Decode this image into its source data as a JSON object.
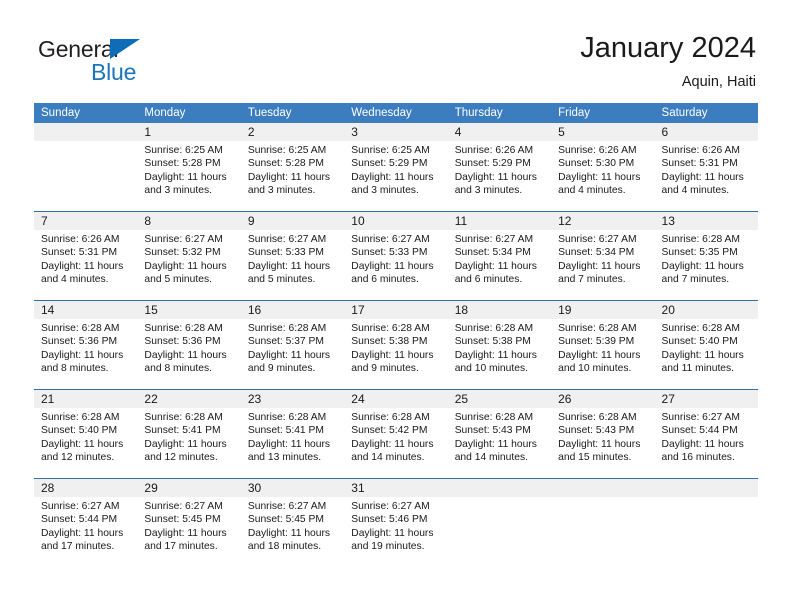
{
  "logo": {
    "word_top": "General",
    "word_bottom": "Blue",
    "triangle_color": "#0f6cb6",
    "blue_color": "#1b75bc"
  },
  "header": {
    "title": "January 2024",
    "subtitle": "Aquin, Haiti",
    "header_bg": "#3c7dc0",
    "row_border": "#2f6fad",
    "date_band_bg": "#f0f0f0"
  },
  "weekdays": [
    "Sunday",
    "Monday",
    "Tuesday",
    "Wednesday",
    "Thursday",
    "Friday",
    "Saturday"
  ],
  "weeks": [
    {
      "days": [
        {
          "num": "",
          "lines": []
        },
        {
          "num": "1",
          "lines": [
            "Sunrise: 6:25 AM",
            "Sunset: 5:28 PM",
            "Daylight: 11 hours",
            "and 3 minutes."
          ]
        },
        {
          "num": "2",
          "lines": [
            "Sunrise: 6:25 AM",
            "Sunset: 5:28 PM",
            "Daylight: 11 hours",
            "and 3 minutes."
          ]
        },
        {
          "num": "3",
          "lines": [
            "Sunrise: 6:25 AM",
            "Sunset: 5:29 PM",
            "Daylight: 11 hours",
            "and 3 minutes."
          ]
        },
        {
          "num": "4",
          "lines": [
            "Sunrise: 6:26 AM",
            "Sunset: 5:29 PM",
            "Daylight: 11 hours",
            "and 3 minutes."
          ]
        },
        {
          "num": "5",
          "lines": [
            "Sunrise: 6:26 AM",
            "Sunset: 5:30 PM",
            "Daylight: 11 hours",
            "and 4 minutes."
          ]
        },
        {
          "num": "6",
          "lines": [
            "Sunrise: 6:26 AM",
            "Sunset: 5:31 PM",
            "Daylight: 11 hours",
            "and 4 minutes."
          ]
        }
      ]
    },
    {
      "days": [
        {
          "num": "7",
          "lines": [
            "Sunrise: 6:26 AM",
            "Sunset: 5:31 PM",
            "Daylight: 11 hours",
            "and 4 minutes."
          ]
        },
        {
          "num": "8",
          "lines": [
            "Sunrise: 6:27 AM",
            "Sunset: 5:32 PM",
            "Daylight: 11 hours",
            "and 5 minutes."
          ]
        },
        {
          "num": "9",
          "lines": [
            "Sunrise: 6:27 AM",
            "Sunset: 5:33 PM",
            "Daylight: 11 hours",
            "and 5 minutes."
          ]
        },
        {
          "num": "10",
          "lines": [
            "Sunrise: 6:27 AM",
            "Sunset: 5:33 PM",
            "Daylight: 11 hours",
            "and 6 minutes."
          ]
        },
        {
          "num": "11",
          "lines": [
            "Sunrise: 6:27 AM",
            "Sunset: 5:34 PM",
            "Daylight: 11 hours",
            "and 6 minutes."
          ]
        },
        {
          "num": "12",
          "lines": [
            "Sunrise: 6:27 AM",
            "Sunset: 5:34 PM",
            "Daylight: 11 hours",
            "and 7 minutes."
          ]
        },
        {
          "num": "13",
          "lines": [
            "Sunrise: 6:28 AM",
            "Sunset: 5:35 PM",
            "Daylight: 11 hours",
            "and 7 minutes."
          ]
        }
      ]
    },
    {
      "days": [
        {
          "num": "14",
          "lines": [
            "Sunrise: 6:28 AM",
            "Sunset: 5:36 PM",
            "Daylight: 11 hours",
            "and 8 minutes."
          ]
        },
        {
          "num": "15",
          "lines": [
            "Sunrise: 6:28 AM",
            "Sunset: 5:36 PM",
            "Daylight: 11 hours",
            "and 8 minutes."
          ]
        },
        {
          "num": "16",
          "lines": [
            "Sunrise: 6:28 AM",
            "Sunset: 5:37 PM",
            "Daylight: 11 hours",
            "and 9 minutes."
          ]
        },
        {
          "num": "17",
          "lines": [
            "Sunrise: 6:28 AM",
            "Sunset: 5:38 PM",
            "Daylight: 11 hours",
            "and 9 minutes."
          ]
        },
        {
          "num": "18",
          "lines": [
            "Sunrise: 6:28 AM",
            "Sunset: 5:38 PM",
            "Daylight: 11 hours",
            "and 10 minutes."
          ]
        },
        {
          "num": "19",
          "lines": [
            "Sunrise: 6:28 AM",
            "Sunset: 5:39 PM",
            "Daylight: 11 hours",
            "and 10 minutes."
          ]
        },
        {
          "num": "20",
          "lines": [
            "Sunrise: 6:28 AM",
            "Sunset: 5:40 PM",
            "Daylight: 11 hours",
            "and 11 minutes."
          ]
        }
      ]
    },
    {
      "days": [
        {
          "num": "21",
          "lines": [
            "Sunrise: 6:28 AM",
            "Sunset: 5:40 PM",
            "Daylight: 11 hours",
            "and 12 minutes."
          ]
        },
        {
          "num": "22",
          "lines": [
            "Sunrise: 6:28 AM",
            "Sunset: 5:41 PM",
            "Daylight: 11 hours",
            "and 12 minutes."
          ]
        },
        {
          "num": "23",
          "lines": [
            "Sunrise: 6:28 AM",
            "Sunset: 5:41 PM",
            "Daylight: 11 hours",
            "and 13 minutes."
          ]
        },
        {
          "num": "24",
          "lines": [
            "Sunrise: 6:28 AM",
            "Sunset: 5:42 PM",
            "Daylight: 11 hours",
            "and 14 minutes."
          ]
        },
        {
          "num": "25",
          "lines": [
            "Sunrise: 6:28 AM",
            "Sunset: 5:43 PM",
            "Daylight: 11 hours",
            "and 14 minutes."
          ]
        },
        {
          "num": "26",
          "lines": [
            "Sunrise: 6:28 AM",
            "Sunset: 5:43 PM",
            "Daylight: 11 hours",
            "and 15 minutes."
          ]
        },
        {
          "num": "27",
          "lines": [
            "Sunrise: 6:27 AM",
            "Sunset: 5:44 PM",
            "Daylight: 11 hours",
            "and 16 minutes."
          ]
        }
      ]
    },
    {
      "days": [
        {
          "num": "28",
          "lines": [
            "Sunrise: 6:27 AM",
            "Sunset: 5:44 PM",
            "Daylight: 11 hours",
            "and 17 minutes."
          ]
        },
        {
          "num": "29",
          "lines": [
            "Sunrise: 6:27 AM",
            "Sunset: 5:45 PM",
            "Daylight: 11 hours",
            "and 17 minutes."
          ]
        },
        {
          "num": "30",
          "lines": [
            "Sunrise: 6:27 AM",
            "Sunset: 5:45 PM",
            "Daylight: 11 hours",
            "and 18 minutes."
          ]
        },
        {
          "num": "31",
          "lines": [
            "Sunrise: 6:27 AM",
            "Sunset: 5:46 PM",
            "Daylight: 11 hours",
            "and 19 minutes."
          ]
        },
        {
          "num": "",
          "lines": []
        },
        {
          "num": "",
          "lines": []
        },
        {
          "num": "",
          "lines": []
        }
      ]
    }
  ]
}
